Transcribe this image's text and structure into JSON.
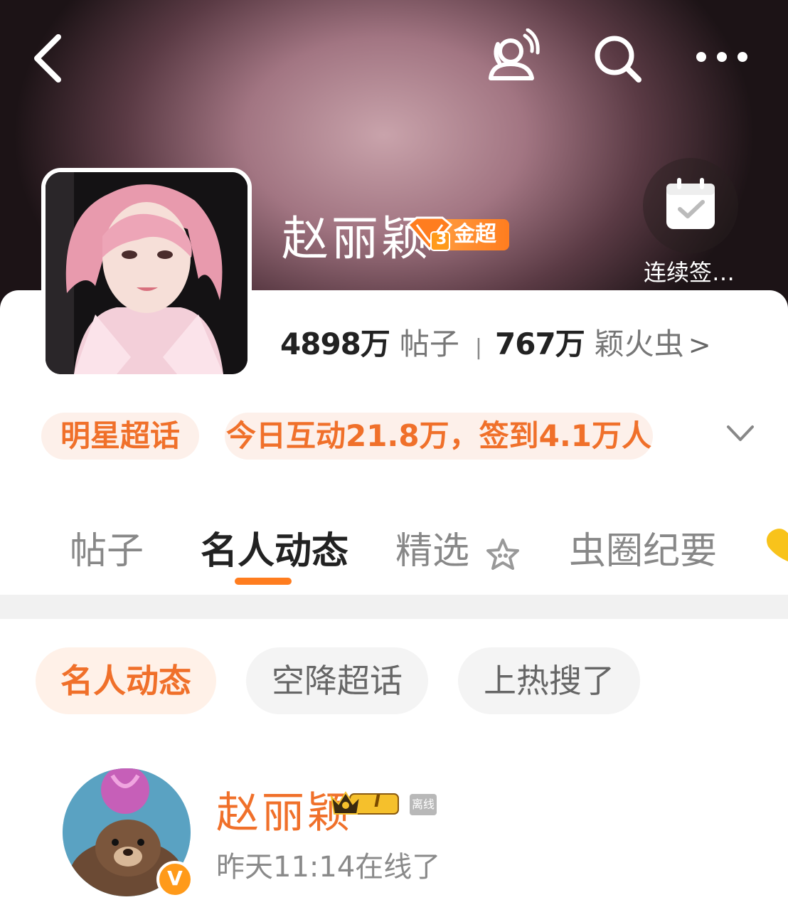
{
  "topbar": {
    "back_icon": "chevron-left-icon",
    "people_icon": "people-broadcast-icon",
    "search_icon": "search-icon",
    "more_icon": "more-dots-icon"
  },
  "profile": {
    "name": "赵丽颖",
    "badge_level": "3",
    "badge_label": "金超",
    "checkin_label": "连续签…",
    "posts_count": "4898万",
    "posts_label": "帖子",
    "fans_count": "767万",
    "fans_label": "颖火虫",
    "fans_chevron": ">"
  },
  "pills": {
    "category": "明星超话",
    "today": "今日互动21.8万，签到4.1万人"
  },
  "tabs": [
    {
      "label": "帖子"
    },
    {
      "label": "名人动态"
    },
    {
      "label": "精选"
    },
    {
      "label": "虫圈纪要"
    }
  ],
  "chips": [
    {
      "label": "名人动态"
    },
    {
      "label": "空降超话"
    },
    {
      "label": "上热搜了"
    }
  ],
  "feed": {
    "user_name": "赵丽颖",
    "rank": "I",
    "offline_label": "离线",
    "verified": "V",
    "status": "昨天11:14在线了"
  },
  "colors": {
    "accent": "#ff7d1f",
    "accent_text": "#f0702a",
    "pill_bg": "#fdf0ea"
  }
}
